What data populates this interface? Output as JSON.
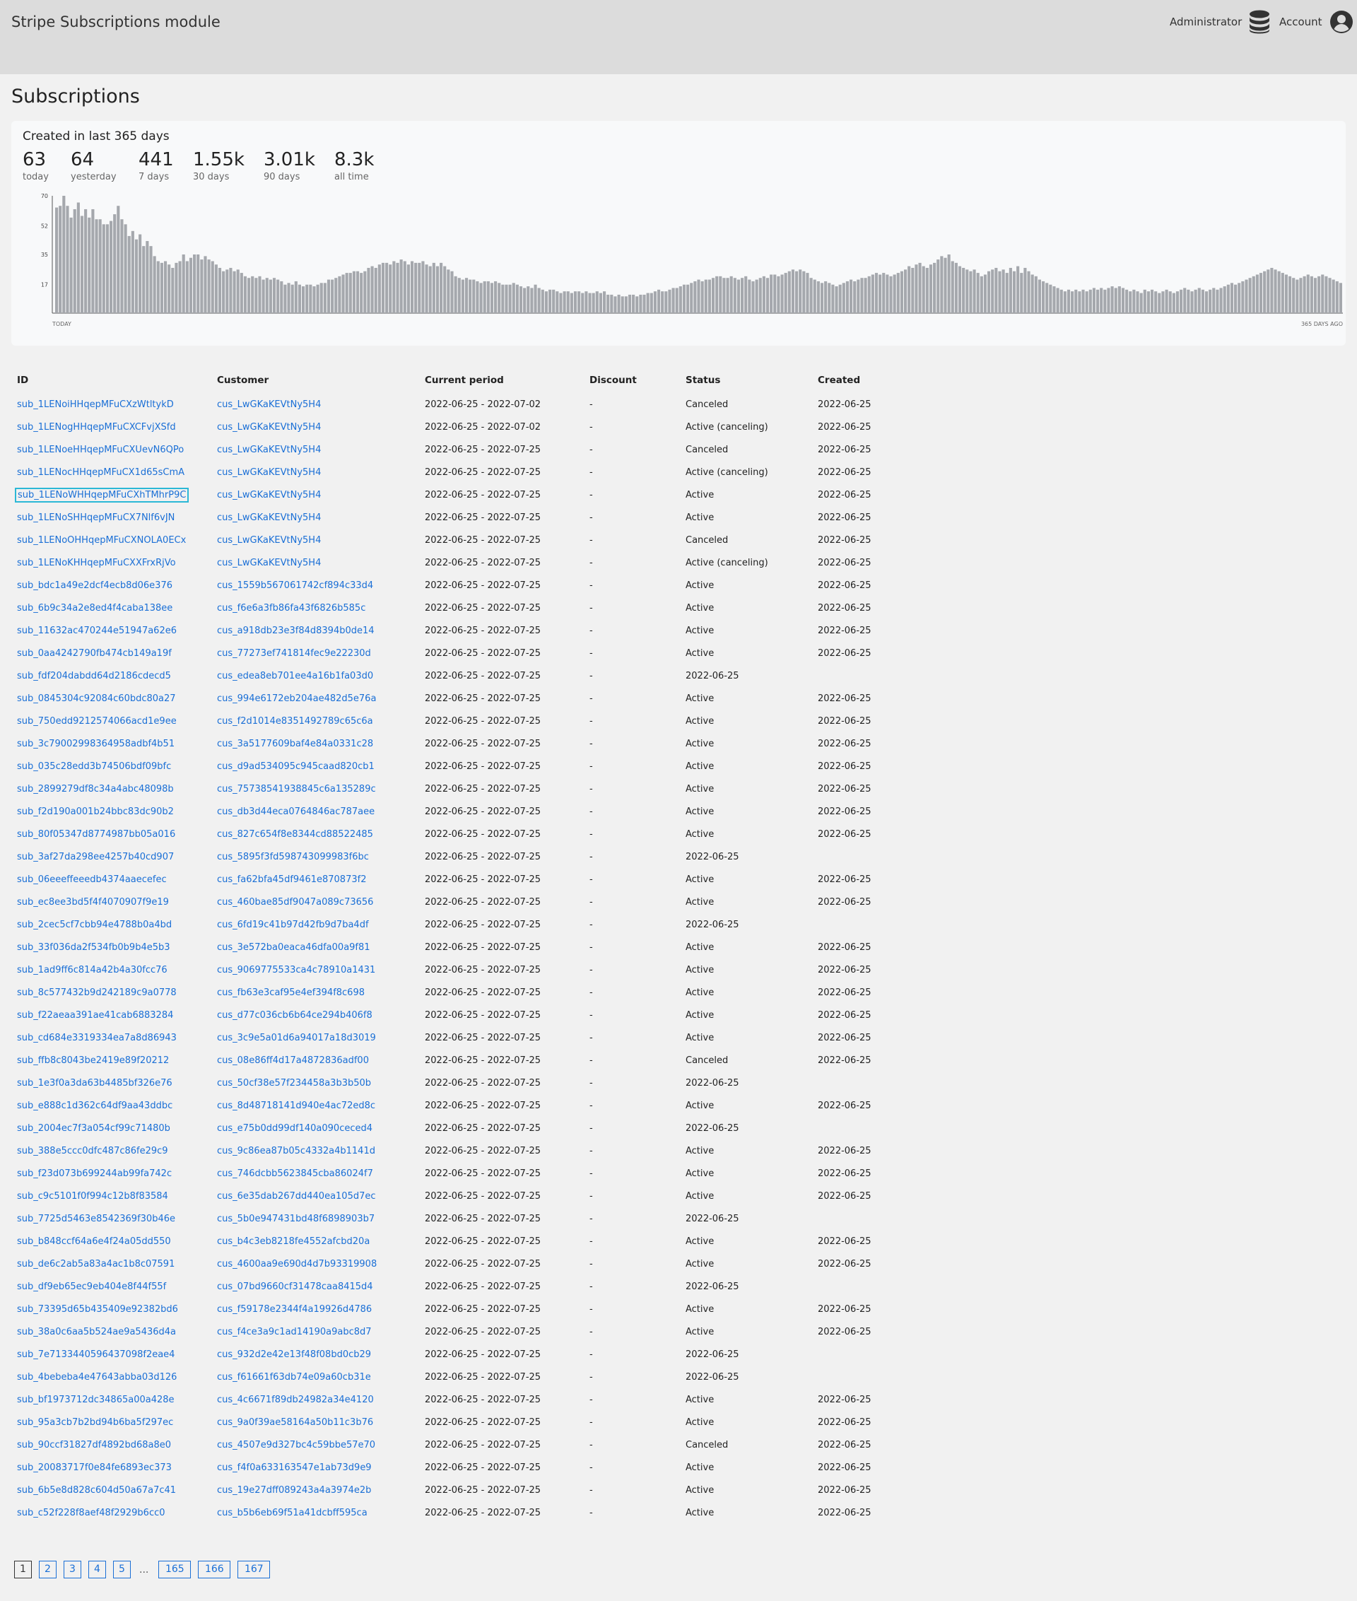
{
  "header": {
    "app_title": "Stripe Subscriptions module",
    "admin_label": "Administrator",
    "account_label": "Account",
    "admin_icon": "database-icon",
    "account_icon": "user-circle-icon"
  },
  "page": {
    "title": "Subscriptions"
  },
  "stats": {
    "heading": "Created in last 365 days",
    "items": [
      {
        "value": "63",
        "label": "today"
      },
      {
        "value": "64",
        "label": "yesterday"
      },
      {
        "value": "441",
        "label": "7 days"
      },
      {
        "value": "1.55k",
        "label": "30 days"
      },
      {
        "value": "3.01k",
        "label": "90 days"
      },
      {
        "value": "8.3k",
        "label": "all time"
      }
    ]
  },
  "chart_data": {
    "type": "bar",
    "title": "",
    "ylim": [
      0,
      70
    ],
    "yticks": [
      "70",
      "52",
      "35",
      "17"
    ],
    "xlabel_left": "TODAY",
    "xlabel_right": "365 DAYS AGO",
    "bar_color": "#a5a8ad",
    "values": [
      63,
      64,
      70,
      64,
      57,
      62,
      66,
      58,
      62,
      57,
      62,
      56,
      56,
      53,
      53,
      55,
      59,
      64,
      56,
      53,
      46,
      49,
      44,
      47,
      40,
      43,
      40,
      34,
      31,
      30,
      31,
      29,
      27,
      30,
      31,
      35,
      31,
      33,
      35,
      35,
      32,
      34,
      32,
      31,
      29,
      27,
      25,
      26,
      27,
      25,
      26,
      24,
      22,
      21,
      22,
      21,
      22,
      20,
      21,
      20,
      21,
      20,
      19,
      17,
      18,
      17,
      19,
      17,
      16,
      17,
      17,
      16,
      17,
      18,
      18,
      20,
      20,
      21,
      22,
      23,
      24,
      24,
      25,
      25,
      24,
      25,
      27,
      28,
      27,
      29,
      30,
      30,
      29,
      31,
      30,
      32,
      31,
      29,
      31,
      30,
      30,
      31,
      29,
      28,
      30,
      28,
      30,
      28,
      26,
      25,
      22,
      21,
      20,
      21,
      20,
      20,
      19,
      18,
      19,
      19,
      18,
      19,
      18,
      17,
      17,
      17,
      18,
      17,
      16,
      15,
      16,
      15,
      17,
      15,
      14,
      13,
      14,
      14,
      13,
      12,
      13,
      13,
      12,
      13,
      13,
      12,
      13,
      12,
      12,
      13,
      12,
      13,
      11,
      11,
      10,
      11,
      10,
      10,
      11,
      11,
      10,
      11,
      11,
      12,
      12,
      13,
      14,
      13,
      13,
      14,
      15,
      15,
      16,
      17,
      17,
      18,
      19,
      20,
      19,
      20,
      20,
      21,
      22,
      22,
      21,
      21,
      22,
      21,
      20,
      21,
      22,
      20,
      19,
      20,
      21,
      22,
      21,
      23,
      23,
      22,
      23,
      24,
      25,
      26,
      25,
      26,
      25,
      24,
      21,
      20,
      19,
      18,
      19,
      18,
      17,
      16,
      17,
      18,
      19,
      20,
      19,
      20,
      21,
      21,
      22,
      23,
      24,
      23,
      24,
      23,
      22,
      23,
      24,
      25,
      26,
      28,
      27,
      29,
      30,
      28,
      27,
      29,
      30,
      32,
      34,
      33,
      35,
      31,
      30,
      28,
      27,
      26,
      25,
      26,
      24,
      22,
      23,
      25,
      26,
      27,
      25,
      26,
      24,
      27,
      25,
      28,
      24,
      27,
      25,
      23,
      22,
      20,
      19,
      18,
      17,
      16,
      15,
      14,
      13,
      14,
      13,
      14,
      13,
      14,
      13,
      14,
      15,
      14,
      15,
      14,
      15,
      16,
      15,
      16,
      15,
      14,
      13,
      14,
      13,
      12,
      14,
      13,
      14,
      13,
      12,
      13,
      14,
      13,
      12,
      13,
      14,
      15,
      14,
      13,
      14,
      15,
      14,
      13,
      14,
      15,
      14,
      15,
      16,
      17,
      18,
      17,
      18,
      19,
      20,
      21,
      22,
      23,
      24,
      25,
      26,
      27,
      26,
      25,
      24,
      23,
      22,
      21,
      20,
      21,
      22,
      23,
      22,
      21,
      22,
      23,
      22,
      21,
      20,
      19,
      18
    ]
  },
  "table": {
    "headers": [
      "ID",
      "Customer",
      "Current period",
      "Discount",
      "Status",
      "Created"
    ],
    "rows": [
      [
        "sub_1LENoiHHqepMFuCXzWtltykD",
        "cus_LwGKaKEVtNy5H4",
        "2022-06-25 - 2022-07-02",
        "-",
        "Canceled",
        "2022-06-25"
      ],
      [
        "sub_1LENogHHqepMFuCXCFvjXSfd",
        "cus_LwGKaKEVtNy5H4",
        "2022-06-25 - 2022-07-02",
        "-",
        "Active (canceling)",
        "2022-06-25"
      ],
      [
        "sub_1LENoeHHqepMFuCXUevN6QPo",
        "cus_LwGKaKEVtNy5H4",
        "2022-06-25 - 2022-07-25",
        "-",
        "Canceled",
        "2022-06-25"
      ],
      [
        "sub_1LENocHHqepMFuCX1d65sCmA",
        "cus_LwGKaKEVtNy5H4",
        "2022-06-25 - 2022-07-25",
        "-",
        "Active (canceling)",
        "2022-06-25"
      ],
      [
        "sub_1LENoWHHqepMFuCXhTMhrP9C",
        "cus_LwGKaKEVtNy5H4",
        "2022-06-25 - 2022-07-25",
        "-",
        "Active",
        "2022-06-25"
      ],
      [
        "sub_1LENoSHHqepMFuCX7Nlf6vJN",
        "cus_LwGKaKEVtNy5H4",
        "2022-06-25 - 2022-07-25",
        "-",
        "Active",
        "2022-06-25"
      ],
      [
        "sub_1LENoOHHqepMFuCXNOLA0ECx",
        "cus_LwGKaKEVtNy5H4",
        "2022-06-25 - 2022-07-25",
        "-",
        "Canceled",
        "2022-06-25"
      ],
      [
        "sub_1LENoKHHqepMFuCXXFrxRjVo",
        "cus_LwGKaKEVtNy5H4",
        "2022-06-25 - 2022-07-25",
        "-",
        "Active (canceling)",
        "2022-06-25"
      ],
      [
        "sub_bdc1a49e2dcf4ecb8d06e376",
        "cus_1559b567061742cf894c33d4",
        "2022-06-25 - 2022-07-25",
        "-",
        "Active",
        "2022-06-25"
      ],
      [
        "sub_6b9c34a2e8ed4f4caba138ee",
        "cus_f6e6a3fb86fa43f6826b585c",
        "2022-06-25 - 2022-07-25",
        "-",
        "Active",
        "2022-06-25"
      ],
      [
        "sub_11632ac470244e51947a62e6",
        "cus_a918db23e3f84d8394b0de14",
        "2022-06-25 - 2022-07-25",
        "-",
        "Active",
        "2022-06-25"
      ],
      [
        "sub_0aa4242790fb474cb149a19f",
        "cus_77273ef741814fec9e22230d",
        "2022-06-25 - 2022-07-25",
        "-",
        "Active",
        "2022-06-25"
      ],
      [
        "sub_fdf204dabdd64d2186cdecd5",
        "cus_edea8eb701ee4a16b1fa03d0",
        "2022-06-25 - 2022-07-25",
        "-",
        "2022-06-25",
        ""
      ],
      [
        "sub_0845304c92084c60bdc80a27",
        "cus_994e6172eb204ae482d5e76a",
        "2022-06-25 - 2022-07-25",
        "-",
        "Active",
        "2022-06-25"
      ],
      [
        "sub_750edd9212574066acd1e9ee",
        "cus_f2d1014e8351492789c65c6a",
        "2022-06-25 - 2022-07-25",
        "-",
        "Active",
        "2022-06-25"
      ],
      [
        "sub_3c79002998364958adbf4b51",
        "cus_3a5177609baf4e84a0331c28",
        "2022-06-25 - 2022-07-25",
        "-",
        "Active",
        "2022-06-25"
      ],
      [
        "sub_035c28edd3b74506bdf09bfc",
        "cus_d9ad534095c945caad820cb1",
        "2022-06-25 - 2022-07-25",
        "-",
        "Active",
        "2022-06-25"
      ],
      [
        "sub_2899279df8c34a4abc48098b",
        "cus_75738541938845c6a135289c",
        "2022-06-25 - 2022-07-25",
        "-",
        "Active",
        "2022-06-25"
      ],
      [
        "sub_f2d190a001b24bbc83dc90b2",
        "cus_db3d44eca0764846ac787aee",
        "2022-06-25 - 2022-07-25",
        "-",
        "Active",
        "2022-06-25"
      ],
      [
        "sub_80f05347d8774987bb05a016",
        "cus_827c654f8e8344cd88522485",
        "2022-06-25 - 2022-07-25",
        "-",
        "Active",
        "2022-06-25"
      ],
      [
        "sub_3af27da298ee4257b40cd907",
        "cus_5895f3fd598743099983f6bc",
        "2022-06-25 - 2022-07-25",
        "-",
        "2022-06-25",
        ""
      ],
      [
        "sub_06eeeffeeedb4374aaecefec",
        "cus_fa62bfa45df9461e870873f2",
        "2022-06-25 - 2022-07-25",
        "-",
        "Active",
        "2022-06-25"
      ],
      [
        "sub_ec8ee3bd5f4f4070907f9e19",
        "cus_460bae85df9047a089c73656",
        "2022-06-25 - 2022-07-25",
        "-",
        "Active",
        "2022-06-25"
      ],
      [
        "sub_2cec5cf7cbb94e4788b0a4bd",
        "cus_6fd19c41b97d42fb9d7ba4df",
        "2022-06-25 - 2022-07-25",
        "-",
        "2022-06-25",
        ""
      ],
      [
        "sub_33f036da2f534fb0b9b4e5b3",
        "cus_3e572ba0eaca46dfa00a9f81",
        "2022-06-25 - 2022-07-25",
        "-",
        "Active",
        "2022-06-25"
      ],
      [
        "sub_1ad9ff6c814a42b4a30fcc76",
        "cus_9069775533ca4c78910a1431",
        "2022-06-25 - 2022-07-25",
        "-",
        "Active",
        "2022-06-25"
      ],
      [
        "sub_8c577432b9d242189c9a0778",
        "cus_fb63e3caf95e4ef394f8c698",
        "2022-06-25 - 2022-07-25",
        "-",
        "Active",
        "2022-06-25"
      ],
      [
        "sub_f22aeaa391ae41cab6883284",
        "cus_d77c036cb6b64ce294b406f8",
        "2022-06-25 - 2022-07-25",
        "-",
        "Active",
        "2022-06-25"
      ],
      [
        "sub_cd684e3319334ea7a8d86943",
        "cus_3c9e5a01d6a94017a18d3019",
        "2022-06-25 - 2022-07-25",
        "-",
        "Active",
        "2022-06-25"
      ],
      [
        "sub_ffb8c8043be2419e89f20212",
        "cus_08e86ff4d17a4872836adf00",
        "2022-06-25 - 2022-07-25",
        "-",
        "Canceled",
        "2022-06-25"
      ],
      [
        "sub_1e3f0a3da63b4485bf326e76",
        "cus_50cf38e57f234458a3b3b50b",
        "2022-06-25 - 2022-07-25",
        "-",
        "2022-06-25",
        ""
      ],
      [
        "sub_e888c1d362c64df9aa43ddbc",
        "cus_8d48718141d940e4ac72ed8c",
        "2022-06-25 - 2022-07-25",
        "-",
        "Active",
        "2022-06-25"
      ],
      [
        "sub_2004ec7f3a054cf99c71480b",
        "cus_e75b0dd99df140a090ceced4",
        "2022-06-25 - 2022-07-25",
        "-",
        "2022-06-25",
        ""
      ],
      [
        "sub_388e5ccc0dfc487c86fe29c9",
        "cus_9c86ea87b05c4332a4b1141d",
        "2022-06-25 - 2022-07-25",
        "-",
        "Active",
        "2022-06-25"
      ],
      [
        "sub_f23d073b699244ab99fa742c",
        "cus_746dcbb5623845cba86024f7",
        "2022-06-25 - 2022-07-25",
        "-",
        "Active",
        "2022-06-25"
      ],
      [
        "sub_c9c5101f0f994c12b8f83584",
        "cus_6e35dab267dd440ea105d7ec",
        "2022-06-25 - 2022-07-25",
        "-",
        "Active",
        "2022-06-25"
      ],
      [
        "sub_7725d5463e8542369f30b46e",
        "cus_5b0e947431bd48f6898903b7",
        "2022-06-25 - 2022-07-25",
        "-",
        "2022-06-25",
        ""
      ],
      [
        "sub_b848ccf64a6e4f24a05dd550",
        "cus_b4c3eb8218fe4552afcbd20a",
        "2022-06-25 - 2022-07-25",
        "-",
        "Active",
        "2022-06-25"
      ],
      [
        "sub_de6c2ab5a83a4ac1b8c07591",
        "cus_4600aa9e690d4d7b93319908",
        "2022-06-25 - 2022-07-25",
        "-",
        "Active",
        "2022-06-25"
      ],
      [
        "sub_df9eb65ec9eb404e8f44f55f",
        "cus_07bd9660cf31478caa8415d4",
        "2022-06-25 - 2022-07-25",
        "-",
        "2022-06-25",
        ""
      ],
      [
        "sub_73395d65b435409e92382bd6",
        "cus_f59178e2344f4a19926d4786",
        "2022-06-25 - 2022-07-25",
        "-",
        "Active",
        "2022-06-25"
      ],
      [
        "sub_38a0c6aa5b524ae9a5436d4a",
        "cus_f4ce3a9c1ad14190a9abc8d7",
        "2022-06-25 - 2022-07-25",
        "-",
        "Active",
        "2022-06-25"
      ],
      [
        "sub_7e713344059643709 8f2eae4",
        "cus_932d2e42e13f48f08bd0cb29",
        "2022-06-25 - 2022-07-25",
        "-",
        "2022-06-25",
        ""
      ],
      [
        "sub_4bebeba4e47643abba03d126",
        "cus_f61661f63db74e09a60cb31e",
        "2022-06-25 - 2022-07-25",
        "-",
        "2022-06-25",
        ""
      ],
      [
        "sub_bf1973712dc34865a00a428e",
        "cus_4c6671f89db24982a34e4120",
        "2022-06-25 - 2022-07-25",
        "-",
        "Active",
        "2022-06-25"
      ],
      [
        "sub_95a3cb7b2bd94b6ba5f297ec",
        "cus_9a0f39ae58164a50b11c3b76",
        "2022-06-25 - 2022-07-25",
        "-",
        "Active",
        "2022-06-25"
      ],
      [
        "sub_90ccf31827df4892bd68a8e0",
        "cus_4507e9d327bc4c59bbe57e70",
        "2022-06-25 - 2022-07-25",
        "-",
        "Canceled",
        "2022-06-25"
      ],
      [
        "sub_20083717f0e84fe6893ec373",
        "cus_f4f0a633163547e1ab73d9e9",
        "2022-06-25 - 2022-07-25",
        "-",
        "Active",
        "2022-06-25"
      ],
      [
        "sub_6b5e8d828c604d50a67a7c41",
        "cus_19e27dff089243a4a3974e2b",
        "2022-06-25 - 2022-07-25",
        "-",
        "Active",
        "2022-06-25"
      ],
      [
        "sub_c52f228f8aef48f2929b6cc0",
        "cus_b5b6eb69f51a41dcbff595ca",
        "2022-06-25 - 2022-07-25",
        "-",
        "Active",
        "2022-06-25"
      ]
    ]
  },
  "pagination": {
    "pages": [
      "1",
      "2",
      "3",
      "4",
      "5"
    ],
    "ellipsis": "...",
    "last_pages": [
      "165",
      "166",
      "167"
    ],
    "current": "1"
  }
}
